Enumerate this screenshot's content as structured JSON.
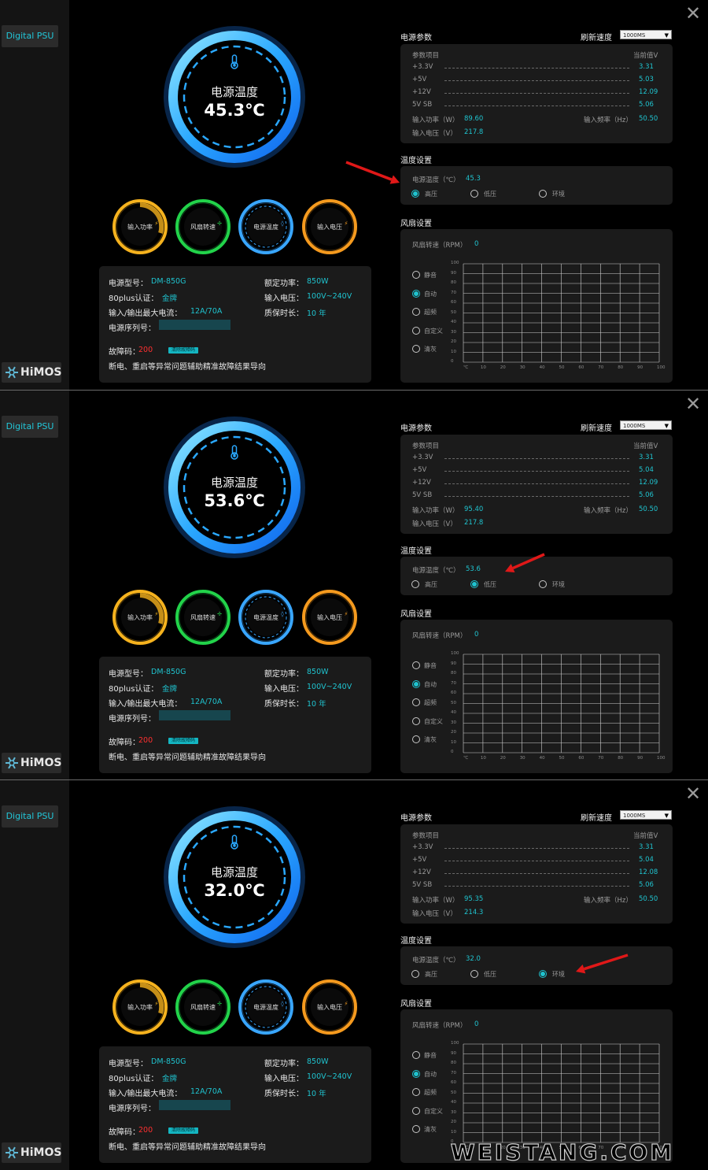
{
  "app": {
    "tab_label": "Digital PSU",
    "logo_text": "HiMOS",
    "close_glyph": "✕"
  },
  "labels": {
    "temp_title": "电源温度",
    "gauges": [
      "输入功率",
      "风扇转速",
      "电源温度",
      "输入电压"
    ],
    "power_params": "电源参数",
    "refresh_speed": "刷新速度",
    "refresh_value": "1000MS",
    "param_item": "参数项目",
    "current_value": "当前值V",
    "rails": [
      "+3.3V",
      "+5V",
      "+12V",
      "5V SB"
    ],
    "input_power": "输入功率（W）",
    "input_freq": "输入频率（Hz）",
    "input_voltage": "输入电压（V）",
    "temp_settings": "温度设置",
    "psu_temp_c": "电源温度（℃）",
    "temp_modes": [
      "高压",
      "低压",
      "环境"
    ],
    "fan_settings": "风扇设置",
    "fan_speed_rpm": "风扇转速（RPM）",
    "fan_modes": [
      "静音",
      "自动",
      "超频",
      "自定义",
      "清灰"
    ],
    "y_ticks": [
      "100",
      "90",
      "80",
      "70",
      "60",
      "50",
      "40",
      "30",
      "20",
      "10",
      "0"
    ],
    "x_ticks": [
      "℃",
      "10",
      "20",
      "30",
      "40",
      "50",
      "60",
      "70",
      "80",
      "90",
      "100"
    ],
    "model_key": "电源型号：",
    "model": "DM-850G",
    "rated_key": "额定功率：",
    "rated": "850W",
    "cert_key": "80plus认证：",
    "cert": "金牌",
    "vin_key": "输入电压：",
    "vin": "100V~240V",
    "imax_key": "输入/输出最大电流：",
    "imax": "12A/70A",
    "warranty_key": "质保时长：",
    "warranty": "10 年",
    "serial_key": "电源序列号：",
    "fault_key": "故障码：",
    "fault": "200",
    "fault_badge": "清除故障码",
    "fault_note": "断电、重启等异常问题辅助精准故障结果导向"
  },
  "panels": [
    {
      "temp": "45.3℃",
      "rails": [
        "3.31",
        "5.03",
        "12.09",
        "5.06"
      ],
      "power": "89.60",
      "freq": "50.50",
      "voltage": "217.8",
      "psu_temp": "45.3",
      "temp_mode_index": 0,
      "fan_rpm": "0",
      "fan_mode_index": 1
    },
    {
      "temp": "53.6℃",
      "rails": [
        "3.31",
        "5.04",
        "12.09",
        "5.06"
      ],
      "power": "95.40",
      "freq": "50.50",
      "voltage": "217.8",
      "psu_temp": "53.6",
      "temp_mode_index": 1,
      "fan_rpm": "0",
      "fan_mode_index": 1
    },
    {
      "temp": "32.0℃",
      "rails": [
        "3.31",
        "5.04",
        "12.08",
        "5.06"
      ],
      "power": "95.35",
      "freq": "50.50",
      "voltage": "214.3",
      "psu_temp": "32.0",
      "temp_mode_index": 2,
      "fan_rpm": "0",
      "fan_mode_index": 1
    }
  ],
  "colors": {
    "accent": "#1fc3cf",
    "ring": "#2a9dff",
    "gauge_power": "#f5b21e",
    "gauge_fan": "#22d34a",
    "gauge_temp": "#39a6ff",
    "gauge_volt": "#f59a1e",
    "fault": "#ff3030",
    "arrow": "#e01818"
  },
  "watermark": "WEISTANG.COM"
}
